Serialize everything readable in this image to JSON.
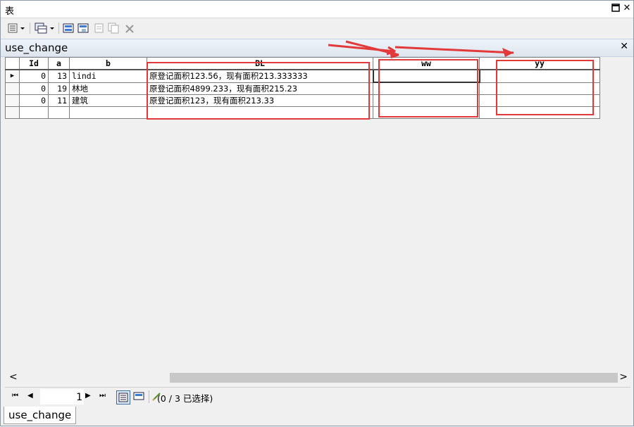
{
  "window": {
    "title": "表"
  },
  "tab": {
    "name": "use_change"
  },
  "table": {
    "columns": [
      "Id",
      "a",
      "b",
      "BL",
      "ww",
      "yy"
    ],
    "rows": [
      {
        "Id": "0",
        "a": "13",
        "b": "lindi",
        "BL": "原登记面积123.56，现有面积213.333333",
        "ww": "",
        "yy": ""
      },
      {
        "Id": "0",
        "a": "19",
        "b": "林地",
        "BL": "原登记面积4899.233，现有面积215.23",
        "ww": "",
        "yy": ""
      },
      {
        "Id": "0",
        "a": "11",
        "b": "建筑",
        "BL": "原登记面积123，现有面积213.33",
        "ww": "",
        "yy": ""
      }
    ]
  },
  "navigation": {
    "current_record": "1",
    "status": "(0 / 3 已选择)"
  },
  "bottom_tab": {
    "name": "use_change"
  },
  "annotation": {
    "color": "#e23a3a"
  },
  "icons": [
    "options-icon",
    "related-tables-icon",
    "select-by-attributes-icon",
    "switch-selection-icon",
    "clear-selection-icon",
    "copy-selected-icon",
    "delete-icon",
    "first-record-icon",
    "previous-record-icon",
    "next-record-icon",
    "last-record-icon",
    "show-all-records-icon",
    "show-selected-records-icon",
    "edit-pencil-icon"
  ]
}
